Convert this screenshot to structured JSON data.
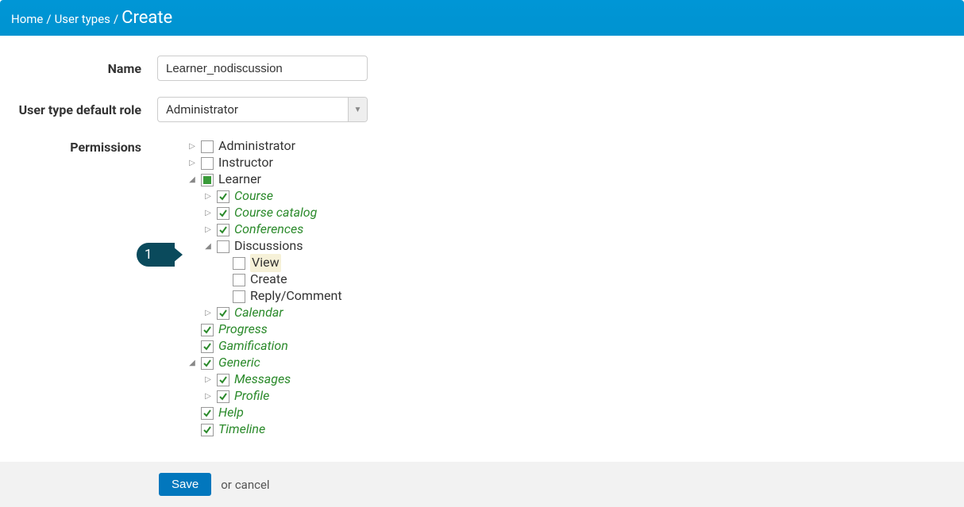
{
  "breadcrumb": {
    "home": "Home",
    "usertypes": "User types",
    "current": "Create"
  },
  "labels": {
    "name": "Name",
    "defaultRole": "User type default role",
    "permissions": "Permissions"
  },
  "form": {
    "name_value": "Learner_nodiscussion",
    "role_value": "Administrator"
  },
  "tree": {
    "administrator": "Administrator",
    "instructor": "Instructor",
    "learner": "Learner",
    "course": "Course",
    "course_catalog": "Course catalog",
    "conferences": "Conferences",
    "discussions": "Discussions",
    "view": "View",
    "create": "Create",
    "reply_comment": "Reply/Comment",
    "calendar": "Calendar",
    "progress": "Progress",
    "gamification": "Gamification",
    "generic": "Generic",
    "messages": "Messages",
    "profile": "Profile",
    "help": "Help",
    "timeline": "Timeline"
  },
  "callout": {
    "num": "1"
  },
  "footer": {
    "save": "Save",
    "or": "or",
    "cancel": "cancel"
  }
}
